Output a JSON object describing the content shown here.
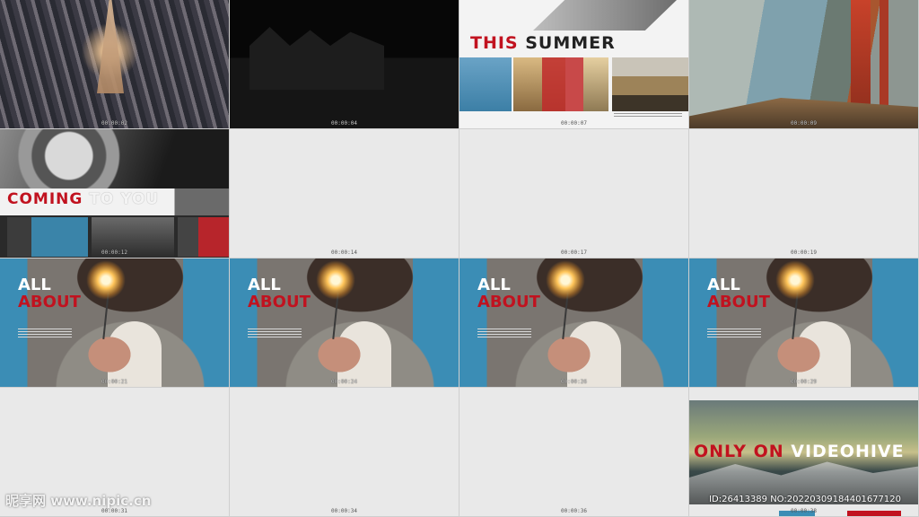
{
  "timestamps": [
    "00:00:02",
    "00:00:04",
    "00:00:07",
    "00:00:09",
    "00:00:12",
    "00:00:14",
    "00:00:17",
    "00:00:19",
    "00:00:21",
    "00:00:24",
    "00:00:26",
    "00:00:29",
    "00:00:31",
    "00:00:34",
    "00:00:36",
    "00:00:38"
  ],
  "cell3": {
    "title_red": "THIS",
    "title_dark": "SUMMER"
  },
  "cell5": {
    "title_red": "COMING",
    "title_white": "TO YOU"
  },
  "sparkler": {
    "line1": "ALL",
    "line2": "ABOUT"
  },
  "cell16": {
    "title_red": "ONLY ON",
    "title_white": "VIDEOHIVE"
  },
  "watermark": "昵享网 www.nipic.cn",
  "id_text": "ID:26413389 NO:20220309184401677120",
  "colors": {
    "accent_red": "#c1121f",
    "panel_grey": "#e9e9e9",
    "sparkler_blue": "#3b8db5"
  }
}
